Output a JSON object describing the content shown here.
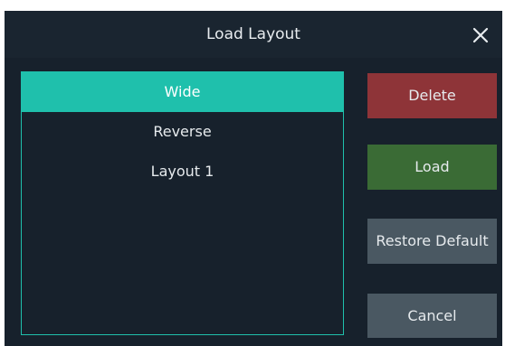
{
  "dialog": {
    "title": "Load Layout",
    "close_icon": "close-icon"
  },
  "layouts": {
    "items": [
      {
        "label": "Wide",
        "selected": true
      },
      {
        "label": "Reverse",
        "selected": false
      },
      {
        "label": "Layout 1",
        "selected": false
      }
    ]
  },
  "buttons": {
    "delete_label": "Delete",
    "load_label": "Load",
    "restore_label": "Restore Default",
    "cancel_label": "Cancel"
  },
  "colors": {
    "background": "#17212c",
    "accent": "#1fc0ac",
    "delete": "#8e3438",
    "load": "#3a6b35",
    "neutral": "#4a5862"
  }
}
